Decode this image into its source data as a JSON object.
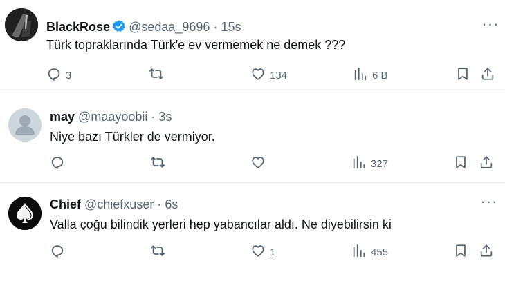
{
  "tweets": [
    {
      "name": "BlackRose",
      "handle": "@sedaa_9696",
      "time": "15s",
      "verified": true,
      "text": "Türk topraklarında Türk'e ev vermemek ne demek  ???",
      "replies": "3",
      "retweets": "",
      "likes": "134",
      "views": "6 B"
    },
    {
      "name": "may",
      "handle": "@maayoobii",
      "time": "3s",
      "verified": false,
      "text": "Niye bazı Türkler de vermiyor.",
      "replies": "",
      "retweets": "",
      "likes": "",
      "views": "327"
    },
    {
      "name": "Chief",
      "handle": "@chiefxuser",
      "time": "6s",
      "verified": false,
      "text": "Valla çoğu bilindik yerleri hep yabancılar aldı. Ne diyebilirsin ki",
      "replies": "",
      "retweets": "",
      "likes": "1",
      "views": "455"
    }
  ],
  "separator": "·",
  "colors": {
    "verified_blue": "#1d9bf0",
    "secondary_text": "#536471",
    "divider": "#e6e9eb"
  },
  "icons": [
    "reply-icon",
    "retweet-icon",
    "like-icon",
    "views-icon",
    "bookmark-icon",
    "share-icon",
    "more-icon",
    "verified-badge-icon"
  ]
}
